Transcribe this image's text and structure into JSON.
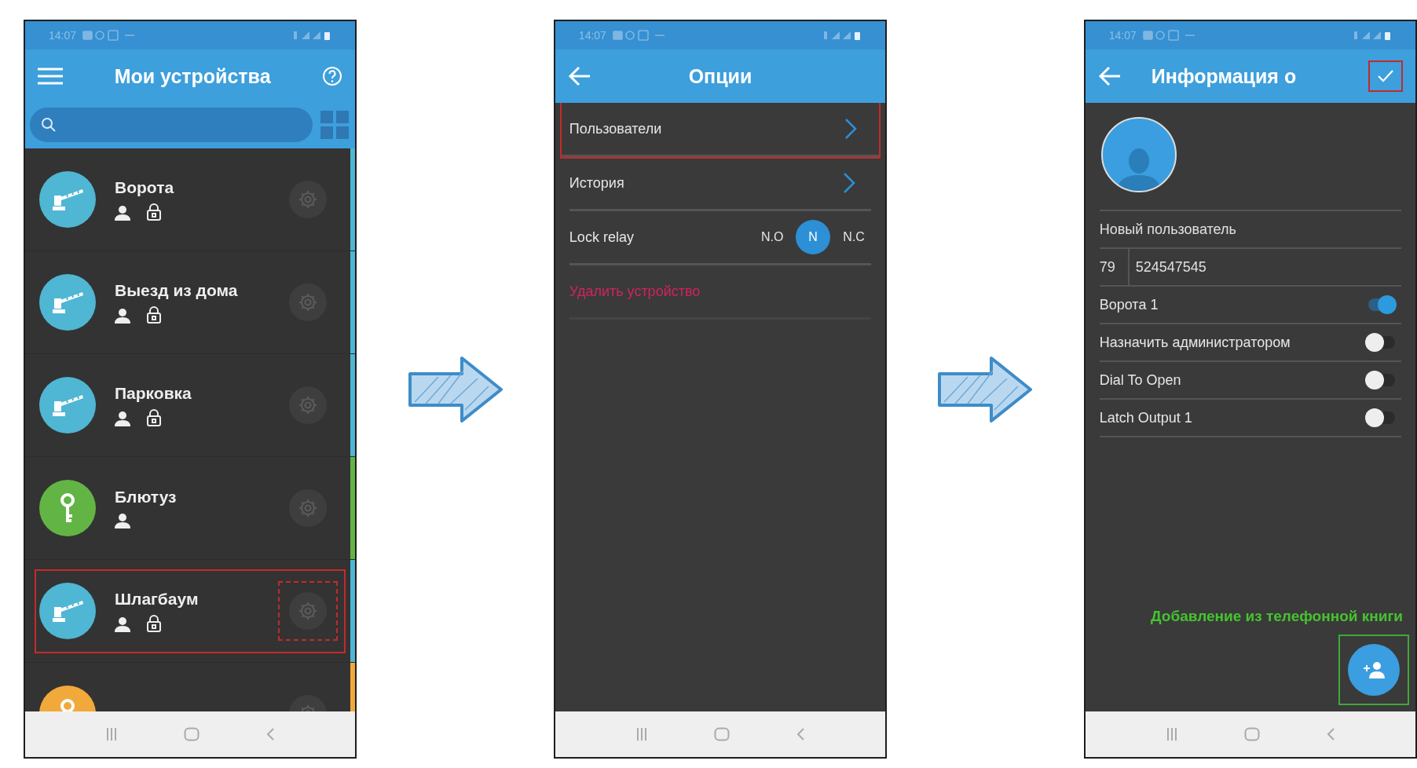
{
  "screens": [
    {
      "kind": "devices",
      "status_time": "14:07",
      "title": "Мои устройства",
      "devices": [
        {
          "name": "Ворота",
          "kind": "barrier",
          "color": "#4fb6d3",
          "user_access": true,
          "locked": true,
          "highlighted": false
        },
        {
          "name": "Выезд из дома",
          "kind": "barrier",
          "color": "#4fb6d3",
          "user_access": true,
          "locked": true,
          "highlighted": false
        },
        {
          "name": "Парковка",
          "kind": "barrier",
          "color": "#4fb6d3",
          "user_access": true,
          "locked": true,
          "highlighted": false
        },
        {
          "name": "Блютуз",
          "kind": "key",
          "color": "#62b544",
          "user_access": true,
          "locked": false,
          "highlighted": false
        },
        {
          "name": "Шлагбаум",
          "kind": "barrier",
          "color": "#4fb6d3",
          "user_access": true,
          "locked": true,
          "highlighted": true
        },
        {
          "kind": "key",
          "color": "#f2a93b",
          "highlighted": false
        }
      ]
    },
    {
      "kind": "options",
      "status_time": "14:07",
      "title": "Опции",
      "rows": [
        {
          "kind": "link",
          "label": "Пользователи",
          "highlighted": true
        },
        {
          "kind": "link",
          "label": "История",
          "highlighted": false
        },
        {
          "kind": "relay",
          "label": "Lock relay",
          "options": [
            {
              "label": "N.O",
              "selected": false
            },
            {
              "label": "N",
              "selected": true
            },
            {
              "label": "N.C",
              "selected": false
            }
          ]
        },
        {
          "kind": "danger",
          "label": "Удалить устройство"
        }
      ]
    },
    {
      "kind": "user",
      "status_time": "14:07",
      "title": "Информация  о",
      "confirm_highlighted": true,
      "name_value": "Новый пользователь",
      "phone_code": "79",
      "phone_number": "524547545",
      "toggles": [
        {
          "label": "Ворота 1",
          "on": true
        },
        {
          "label": "Назначить администратором",
          "on": false
        },
        {
          "label": "Dial To Open",
          "on": false
        },
        {
          "label": "Latch Output 1",
          "on": false
        }
      ],
      "hint": "Добавление из телефонной книги",
      "fab_highlighted": true
    }
  ]
}
